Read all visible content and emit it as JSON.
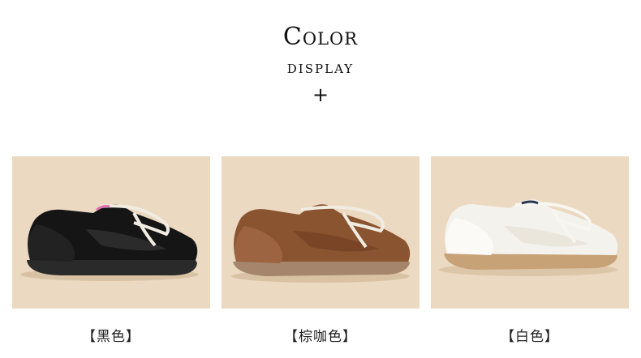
{
  "header": {
    "title": "Color",
    "subtitle": "display",
    "plus": "+"
  },
  "products": [
    {
      "label": "【黑色】",
      "color": "#1b1b1b"
    },
    {
      "label": "【棕咖色】",
      "color": "#8a5430"
    },
    {
      "label": "【白色】",
      "color": "#f4f2ec"
    }
  ],
  "background_color": "#ead8bf"
}
